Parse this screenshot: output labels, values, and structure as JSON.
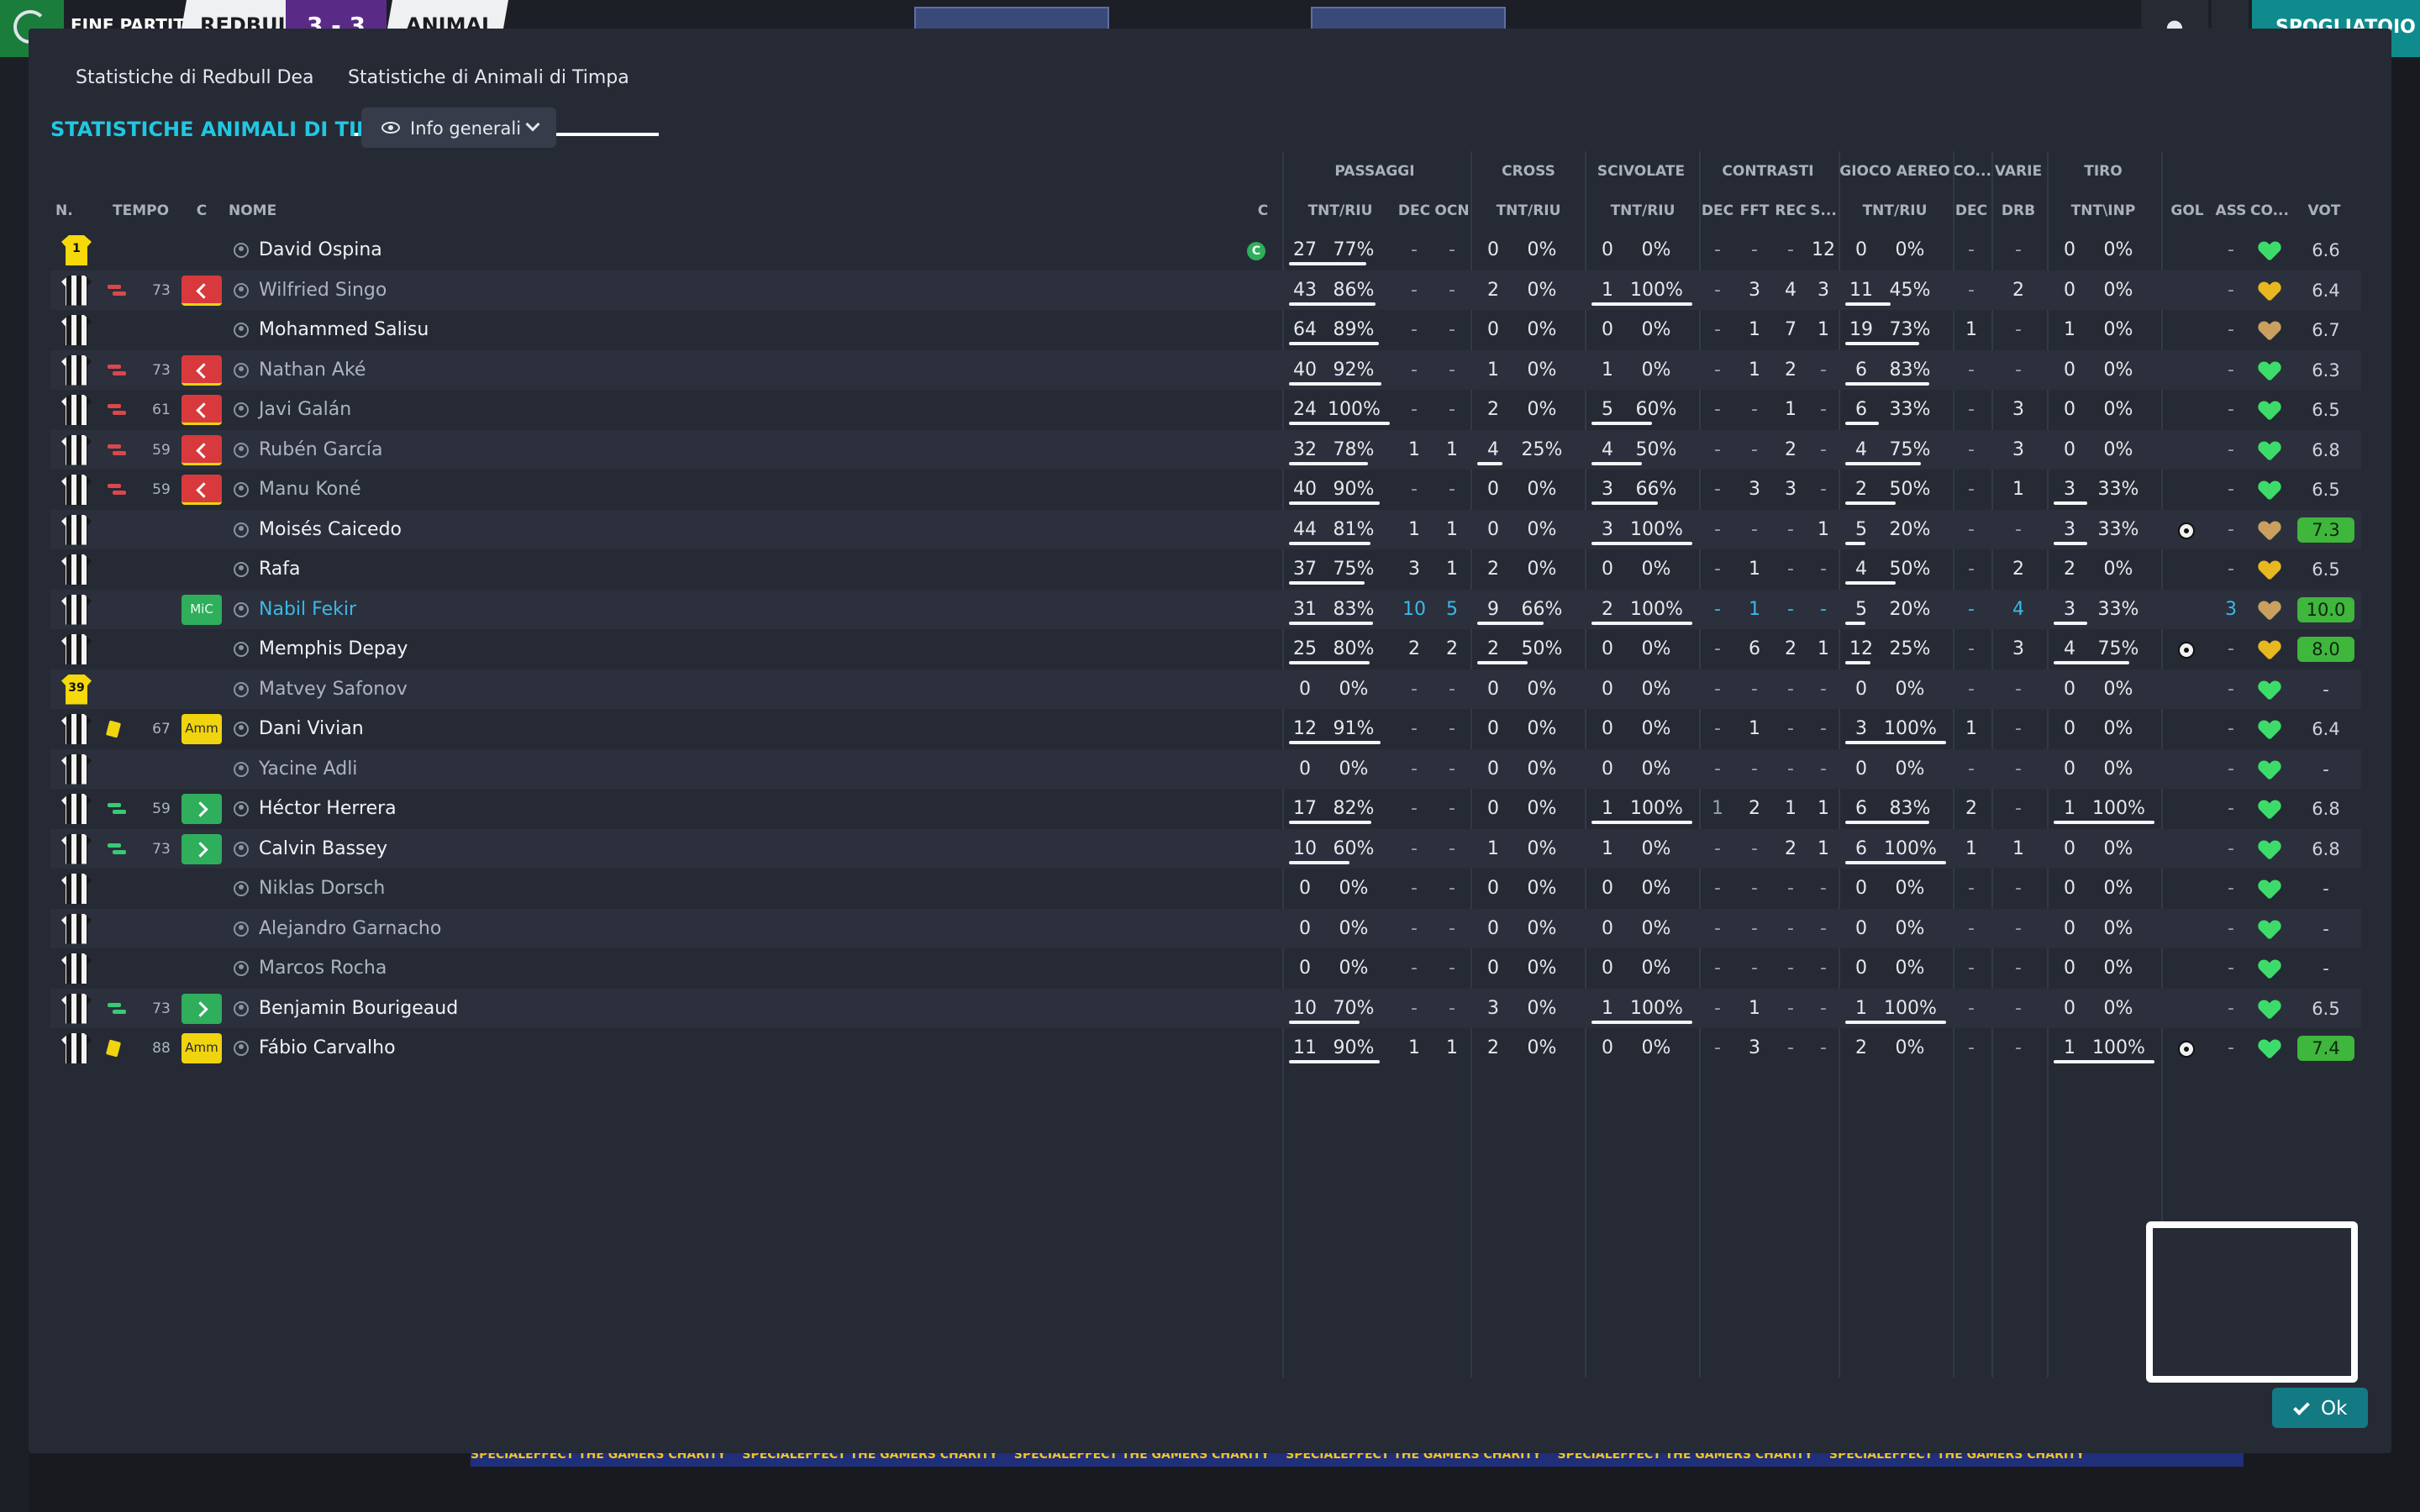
{
  "topbar": {
    "status": "FINE PARTITA",
    "home_team": "REDBUL",
    "score": "3 - 3",
    "away_team": "ANIMAL",
    "right_button": "SPOGLIATOIO"
  },
  "tabs": [
    {
      "label": "Statistiche di Redbull Dea",
      "active": false
    },
    {
      "label": "Statistiche di Animali di Timpa",
      "active": true
    }
  ],
  "title": "STATISTICHE ANIMALI DI TIMPA",
  "view_select": {
    "selected": "Info generali"
  },
  "groups": {
    "passaggi": "PASSAGGI",
    "cross": "CROSS",
    "scivolate": "SCIVOLATE",
    "contrasti": "CONTRASTI",
    "gioco_aereo": "GIOCO AEREO",
    "co": "CO...",
    "varie": "VARIE",
    "tiro": "TIRO"
  },
  "columns": {
    "n": "N.",
    "tempo": "TEMPO",
    "c": "C",
    "nome": "NOME",
    "cap": "C",
    "pass_tnt": "TNT/RIU",
    "dec": "DEC",
    "ocn": "OCN",
    "cross_tnt": "TNT/RIU",
    "sciv_tnt": "TNT/RIU",
    "contr_dec": "DEC",
    "fft": "FFT",
    "rec": "REC",
    "s": "S...",
    "aereo_tnt": "TNT/RIU",
    "co_dec": "DEC",
    "drb": "DRB",
    "tiro_tnt": "TNT\\INP",
    "gol": "GOL",
    "ass": "ASS",
    "co": "CO...",
    "vot": "VOT"
  },
  "players": [
    {
      "no": "1",
      "gk": true,
      "tempo": "",
      "sub": "",
      "card": "",
      "role": "",
      "name": "David Ospina",
      "dim": false,
      "hi": false,
      "cap": "C",
      "p1": "27",
      "p2": "77%",
      "pb": 77,
      "dec": "-",
      "ocn": "-",
      "c1": "0",
      "c2": "0%",
      "cb": 0,
      "s1": "0",
      "s2": "0%",
      "sb": 0,
      "cd": "-",
      "fft": "-",
      "rec": "-",
      "sx": "12",
      "a1": "0",
      "a2": "0%",
      "ab": 0,
      "codec": "-",
      "drb": "-",
      "t1": "0",
      "t2": "0%",
      "tb": 0,
      "gol": "",
      "ass": "-",
      "mood": "g",
      "vot": "6.6",
      "best": false
    },
    {
      "no": "",
      "gk": false,
      "tempo": "73",
      "sub": "out",
      "card": "",
      "role": "out",
      "name": "Wilfried Singo",
      "dim": true,
      "hi": false,
      "cap": "",
      "p1": "43",
      "p2": "86%",
      "pb": 86,
      "dec": "-",
      "ocn": "-",
      "c1": "2",
      "c2": "0%",
      "cb": 0,
      "s1": "1",
      "s2": "100%",
      "sb": 100,
      "cd": "-",
      "fft": "3",
      "rec": "4",
      "sx": "3",
      "a1": "11",
      "a2": "45%",
      "ab": 45,
      "codec": "-",
      "drb": "2",
      "t1": "0",
      "t2": "0%",
      "tb": 0,
      "gol": "",
      "ass": "-",
      "mood": "y",
      "vot": "6.4",
      "best": false
    },
    {
      "no": "",
      "gk": false,
      "tempo": "",
      "sub": "",
      "card": "",
      "role": "",
      "name": "Mohammed Salisu",
      "dim": false,
      "hi": false,
      "cap": "",
      "p1": "64",
      "p2": "89%",
      "pb": 89,
      "dec": "-",
      "ocn": "-",
      "c1": "0",
      "c2": "0%",
      "cb": 0,
      "s1": "0",
      "s2": "0%",
      "sb": 0,
      "cd": "-",
      "fft": "1",
      "rec": "7",
      "sx": "1",
      "a1": "19",
      "a2": "73%",
      "ab": 73,
      "codec": "1",
      "drb": "-",
      "t1": "1",
      "t2": "0%",
      "tb": 0,
      "gol": "",
      "ass": "-",
      "mood": "o",
      "vot": "6.7",
      "best": false
    },
    {
      "no": "",
      "gk": false,
      "tempo": "73",
      "sub": "out",
      "card": "",
      "role": "out",
      "name": "Nathan Aké",
      "dim": true,
      "hi": false,
      "cap": "",
      "p1": "40",
      "p2": "92%",
      "pb": 92,
      "dec": "-",
      "ocn": "-",
      "c1": "1",
      "c2": "0%",
      "cb": 0,
      "s1": "1",
      "s2": "0%",
      "sb": 0,
      "cd": "-",
      "fft": "1",
      "rec": "2",
      "sx": "-",
      "a1": "6",
      "a2": "83%",
      "ab": 83,
      "codec": "-",
      "drb": "-",
      "t1": "0",
      "t2": "0%",
      "tb": 0,
      "gol": "",
      "ass": "-",
      "mood": "g",
      "vot": "6.3",
      "best": false
    },
    {
      "no": "",
      "gk": false,
      "tempo": "61",
      "sub": "out",
      "card": "",
      "role": "out",
      "name": "Javi Galán",
      "dim": true,
      "hi": false,
      "cap": "",
      "p1": "24",
      "p2": "100%",
      "pb": 100,
      "dec": "-",
      "ocn": "-",
      "c1": "2",
      "c2": "0%",
      "cb": 0,
      "s1": "5",
      "s2": "60%",
      "sb": 60,
      "cd": "-",
      "fft": "-",
      "rec": "1",
      "sx": "-",
      "a1": "6",
      "a2": "33%",
      "ab": 33,
      "codec": "-",
      "drb": "3",
      "t1": "0",
      "t2": "0%",
      "tb": 0,
      "gol": "",
      "ass": "-",
      "mood": "g",
      "vot": "6.5",
      "best": false
    },
    {
      "no": "",
      "gk": false,
      "tempo": "59",
      "sub": "out",
      "card": "",
      "role": "out",
      "name": "Rubén García",
      "dim": true,
      "hi": false,
      "cap": "",
      "p1": "32",
      "p2": "78%",
      "pb": 78,
      "dec": "1",
      "ocn": "1",
      "c1": "4",
      "c2": "25%",
      "cb": 25,
      "s1": "4",
      "s2": "50%",
      "sb": 50,
      "cd": "-",
      "fft": "-",
      "rec": "2",
      "sx": "-",
      "a1": "4",
      "a2": "75%",
      "ab": 75,
      "codec": "-",
      "drb": "3",
      "t1": "0",
      "t2": "0%",
      "tb": 0,
      "gol": "",
      "ass": "-",
      "mood": "g",
      "vot": "6.8",
      "best": false
    },
    {
      "no": "",
      "gk": false,
      "tempo": "59",
      "sub": "out",
      "card": "",
      "role": "out",
      "name": "Manu Koné",
      "dim": true,
      "hi": false,
      "cap": "",
      "p1": "40",
      "p2": "90%",
      "pb": 90,
      "dec": "-",
      "ocn": "-",
      "c1": "0",
      "c2": "0%",
      "cb": 0,
      "s1": "3",
      "s2": "66%",
      "sb": 66,
      "cd": "-",
      "fft": "3",
      "rec": "3",
      "sx": "-",
      "a1": "2",
      "a2": "50%",
      "ab": 50,
      "codec": "-",
      "drb": "1",
      "t1": "3",
      "t2": "33%",
      "tb": 33,
      "gol": "",
      "ass": "-",
      "mood": "g",
      "vot": "6.5",
      "best": false
    },
    {
      "no": "",
      "gk": false,
      "tempo": "",
      "sub": "",
      "card": "",
      "role": "",
      "name": "Moisés Caicedo",
      "dim": false,
      "hi": false,
      "cap": "",
      "p1": "44",
      "p2": "81%",
      "pb": 81,
      "dec": "1",
      "ocn": "1",
      "c1": "0",
      "c2": "0%",
      "cb": 0,
      "s1": "3",
      "s2": "100%",
      "sb": 100,
      "cd": "-",
      "fft": "-",
      "rec": "-",
      "sx": "1",
      "a1": "5",
      "a2": "20%",
      "ab": 20,
      "codec": "-",
      "drb": "-",
      "t1": "3",
      "t2": "33%",
      "tb": 33,
      "gol": "ball",
      "ass": "-",
      "mood": "o",
      "vot": "7.3",
      "best": true
    },
    {
      "no": "",
      "gk": false,
      "tempo": "",
      "sub": "",
      "card": "",
      "role": "",
      "name": "Rafa",
      "dim": false,
      "hi": false,
      "cap": "",
      "p1": "37",
      "p2": "75%",
      "pb": 75,
      "dec": "3",
      "ocn": "1",
      "c1": "2",
      "c2": "0%",
      "cb": 0,
      "s1": "0",
      "s2": "0%",
      "sb": 0,
      "cd": "-",
      "fft": "1",
      "rec": "-",
      "sx": "-",
      "a1": "4",
      "a2": "50%",
      "ab": 50,
      "codec": "-",
      "drb": "2",
      "t1": "2",
      "t2": "0%",
      "tb": 0,
      "gol": "",
      "ass": "-",
      "mood": "y",
      "vot": "6.5",
      "best": false
    },
    {
      "no": "",
      "gk": false,
      "tempo": "",
      "sub": "",
      "card": "",
      "role": "mic",
      "name": "Nabil Fekir",
      "dim": false,
      "hi": true,
      "cap": "",
      "p1": "31",
      "p2": "83%",
      "pb": 83,
      "dec": "10",
      "ocn": "5",
      "c1": "9",
      "c2": "66%",
      "cb": 66,
      "s1": "2",
      "s2": "100%",
      "sb": 100,
      "cd": "-",
      "fft": "1",
      "rec": "-",
      "sx": "-",
      "a1": "5",
      "a2": "20%",
      "ab": 20,
      "codec": "-",
      "drb": "4",
      "t1": "3",
      "t2": "33%",
      "tb": 33,
      "gol": "",
      "ass": "3",
      "mood": "o",
      "vot": "10.0",
      "best": true
    },
    {
      "no": "",
      "gk": false,
      "tempo": "",
      "sub": "",
      "card": "",
      "role": "",
      "name": "Memphis Depay",
      "dim": false,
      "hi": false,
      "cap": "",
      "p1": "25",
      "p2": "80%",
      "pb": 80,
      "dec": "2",
      "ocn": "2",
      "c1": "2",
      "c2": "50%",
      "cb": 50,
      "s1": "0",
      "s2": "0%",
      "sb": 0,
      "cd": "-",
      "fft": "6",
      "rec": "2",
      "sx": "1",
      "a1": "12",
      "a2": "25%",
      "ab": 25,
      "codec": "-",
      "drb": "3",
      "t1": "4",
      "t2": "75%",
      "tb": 75,
      "gol": "ball",
      "ass": "-",
      "mood": "y",
      "vot": "8.0",
      "best": true
    },
    {
      "no": "39",
      "gk": true,
      "tempo": "",
      "sub": "",
      "card": "",
      "role": "",
      "name": "Matvey Safonov",
      "dim": true,
      "hi": false,
      "cap": "",
      "p1": "0",
      "p2": "0%",
      "pb": 0,
      "dec": "-",
      "ocn": "-",
      "c1": "0",
      "c2": "0%",
      "cb": 0,
      "s1": "0",
      "s2": "0%",
      "sb": 0,
      "cd": "-",
      "fft": "-",
      "rec": "-",
      "sx": "-",
      "a1": "0",
      "a2": "0%",
      "ab": 0,
      "codec": "-",
      "drb": "-",
      "t1": "0",
      "t2": "0%",
      "tb": 0,
      "gol": "",
      "ass": "-",
      "mood": "g",
      "vot": "-",
      "best": false
    },
    {
      "no": "",
      "gk": false,
      "tempo": "67",
      "sub": "",
      "card": "y",
      "role": "amm",
      "name": "Dani Vivian",
      "dim": false,
      "hi": false,
      "cap": "",
      "p1": "12",
      "p2": "91%",
      "pb": 91,
      "dec": "-",
      "ocn": "-",
      "c1": "0",
      "c2": "0%",
      "cb": 0,
      "s1": "0",
      "s2": "0%",
      "sb": 0,
      "cd": "-",
      "fft": "1",
      "rec": "-",
      "sx": "-",
      "a1": "3",
      "a2": "100%",
      "ab": 100,
      "codec": "1",
      "drb": "-",
      "t1": "0",
      "t2": "0%",
      "tb": 0,
      "gol": "",
      "ass": "-",
      "mood": "g",
      "vot": "6.4",
      "best": false
    },
    {
      "no": "",
      "gk": false,
      "tempo": "",
      "sub": "",
      "card": "",
      "role": "",
      "name": "Yacine Adli",
      "dim": true,
      "hi": false,
      "cap": "",
      "p1": "0",
      "p2": "0%",
      "pb": 0,
      "dec": "-",
      "ocn": "-",
      "c1": "0",
      "c2": "0%",
      "cb": 0,
      "s1": "0",
      "s2": "0%",
      "sb": 0,
      "cd": "-",
      "fft": "-",
      "rec": "-",
      "sx": "-",
      "a1": "0",
      "a2": "0%",
      "ab": 0,
      "codec": "-",
      "drb": "-",
      "t1": "0",
      "t2": "0%",
      "tb": 0,
      "gol": "",
      "ass": "-",
      "mood": "g",
      "vot": "-",
      "best": false
    },
    {
      "no": "",
      "gk": false,
      "tempo": "59",
      "sub": "in",
      "card": "",
      "role": "in",
      "name": "Héctor Herrera",
      "dim": false,
      "hi": false,
      "cap": "",
      "p1": "17",
      "p2": "82%",
      "pb": 82,
      "dec": "-",
      "ocn": "-",
      "c1": "0",
      "c2": "0%",
      "cb": 0,
      "s1": "1",
      "s2": "100%",
      "sb": 100,
      "cd": "1",
      "fft": "2",
      "rec": "1",
      "sx": "1",
      "a1": "6",
      "a2": "83%",
      "ab": 83,
      "codec": "2",
      "drb": "-",
      "t1": "1",
      "t2": "100%",
      "tb": 100,
      "gol": "",
      "ass": "-",
      "mood": "g",
      "vot": "6.8",
      "best": false
    },
    {
      "no": "",
      "gk": false,
      "tempo": "73",
      "sub": "in",
      "card": "",
      "role": "in",
      "name": "Calvin Bassey",
      "dim": false,
      "hi": false,
      "cap": "",
      "p1": "10",
      "p2": "60%",
      "pb": 60,
      "dec": "-",
      "ocn": "-",
      "c1": "1",
      "c2": "0%",
      "cb": 0,
      "s1": "1",
      "s2": "0%",
      "sb": 0,
      "cd": "-",
      "fft": "-",
      "rec": "2",
      "sx": "1",
      "a1": "6",
      "a2": "100%",
      "ab": 100,
      "codec": "1",
      "drb": "1",
      "t1": "0",
      "t2": "0%",
      "tb": 0,
      "gol": "",
      "ass": "-",
      "mood": "g",
      "vot": "6.8",
      "best": false
    },
    {
      "no": "",
      "gk": false,
      "tempo": "",
      "sub": "",
      "card": "",
      "role": "",
      "name": "Niklas Dorsch",
      "dim": true,
      "hi": false,
      "cap": "",
      "p1": "0",
      "p2": "0%",
      "pb": 0,
      "dec": "-",
      "ocn": "-",
      "c1": "0",
      "c2": "0%",
      "cb": 0,
      "s1": "0",
      "s2": "0%",
      "sb": 0,
      "cd": "-",
      "fft": "-",
      "rec": "-",
      "sx": "-",
      "a1": "0",
      "a2": "0%",
      "ab": 0,
      "codec": "-",
      "drb": "-",
      "t1": "0",
      "t2": "0%",
      "tb": 0,
      "gol": "",
      "ass": "-",
      "mood": "g",
      "vot": "-",
      "best": false
    },
    {
      "no": "",
      "gk": false,
      "tempo": "",
      "sub": "",
      "card": "",
      "role": "",
      "name": "Alejandro Garnacho",
      "dim": true,
      "hi": false,
      "cap": "",
      "p1": "0",
      "p2": "0%",
      "pb": 0,
      "dec": "-",
      "ocn": "-",
      "c1": "0",
      "c2": "0%",
      "cb": 0,
      "s1": "0",
      "s2": "0%",
      "sb": 0,
      "cd": "-",
      "fft": "-",
      "rec": "-",
      "sx": "-",
      "a1": "0",
      "a2": "0%",
      "ab": 0,
      "codec": "-",
      "drb": "-",
      "t1": "0",
      "t2": "0%",
      "tb": 0,
      "gol": "",
      "ass": "-",
      "mood": "g",
      "vot": "-",
      "best": false
    },
    {
      "no": "",
      "gk": false,
      "tempo": "",
      "sub": "",
      "card": "",
      "role": "",
      "name": "Marcos Rocha",
      "dim": true,
      "hi": false,
      "cap": "",
      "p1": "0",
      "p2": "0%",
      "pb": 0,
      "dec": "-",
      "ocn": "-",
      "c1": "0",
      "c2": "0%",
      "cb": 0,
      "s1": "0",
      "s2": "0%",
      "sb": 0,
      "cd": "-",
      "fft": "-",
      "rec": "-",
      "sx": "-",
      "a1": "0",
      "a2": "0%",
      "ab": 0,
      "codec": "-",
      "drb": "-",
      "t1": "0",
      "t2": "0%",
      "tb": 0,
      "gol": "",
      "ass": "-",
      "mood": "g",
      "vot": "-",
      "best": false
    },
    {
      "no": "",
      "gk": false,
      "tempo": "73",
      "sub": "in",
      "card": "",
      "role": "in",
      "name": "Benjamin Bourigeaud",
      "dim": false,
      "hi": false,
      "cap": "",
      "p1": "10",
      "p2": "70%",
      "pb": 70,
      "dec": "-",
      "ocn": "-",
      "c1": "3",
      "c2": "0%",
      "cb": 0,
      "s1": "1",
      "s2": "100%",
      "sb": 100,
      "cd": "-",
      "fft": "1",
      "rec": "-",
      "sx": "-",
      "a1": "1",
      "a2": "100%",
      "ab": 100,
      "codec": "-",
      "drb": "-",
      "t1": "0",
      "t2": "0%",
      "tb": 0,
      "gol": "",
      "ass": "-",
      "mood": "g",
      "vot": "6.5",
      "best": false
    },
    {
      "no": "",
      "gk": false,
      "tempo": "88",
      "sub": "",
      "card": "y",
      "role": "amm",
      "name": "Fábio Carvalho",
      "dim": false,
      "hi": false,
      "cap": "",
      "p1": "11",
      "p2": "90%",
      "pb": 90,
      "dec": "1",
      "ocn": "1",
      "c1": "2",
      "c2": "0%",
      "cb": 0,
      "s1": "0",
      "s2": "0%",
      "sb": 0,
      "cd": "-",
      "fft": "3",
      "rec": "-",
      "sx": "-",
      "a1": "2",
      "a2": "0%",
      "ab": 0,
      "codec": "-",
      "drb": "-",
      "t1": "1",
      "t2": "100%",
      "tb": 100,
      "gol": "ball",
      "ass": "-",
      "mood": "g",
      "vot": "7.4",
      "best": true
    }
  ],
  "role_labels": {
    "amm": "Amm",
    "mic": "MiC"
  },
  "ok_label": "Ok",
  "ticker": "SPECIALEFFECT THE GAMERS CHARITY"
}
